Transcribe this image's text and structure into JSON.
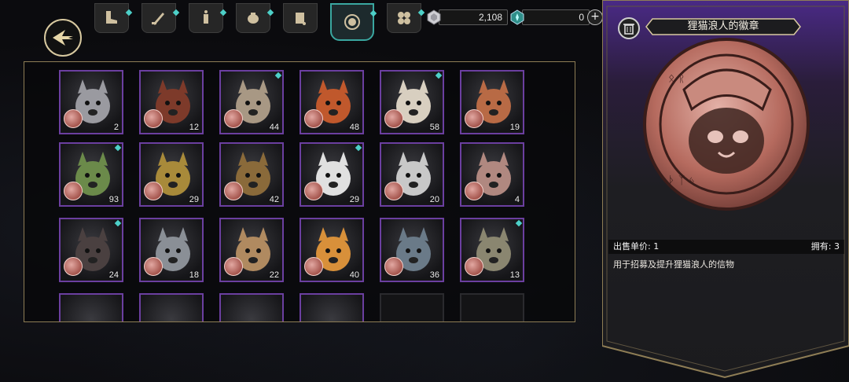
{
  "currencies": [
    {
      "icon": "silver-gem-icon",
      "value": "2,108"
    },
    {
      "icon": "teal-crystal-icon",
      "value": "0"
    }
  ],
  "tabs": [
    {
      "icon": "boot-icon",
      "new": true
    },
    {
      "icon": "sword-icon",
      "new": true
    },
    {
      "icon": "candle-icon",
      "new": true
    },
    {
      "icon": "pouch-icon",
      "new": true
    },
    {
      "icon": "scroll-icon",
      "new": false
    },
    {
      "icon": "coin-badge-icon",
      "new": true,
      "active": true
    },
    {
      "icon": "clover-icon",
      "new": true
    }
  ],
  "items": [
    {
      "count": "2",
      "new": false,
      "fur": "#9a9aa0"
    },
    {
      "count": "12",
      "new": false,
      "fur": "#7d3a2a"
    },
    {
      "count": "44",
      "new": true,
      "fur": "#a89884"
    },
    {
      "count": "48",
      "new": false,
      "fur": "#c0582c"
    },
    {
      "count": "58",
      "new": true,
      "fur": "#d8cfc0"
    },
    {
      "count": "19",
      "new": false,
      "fur": "#b86a45"
    },
    {
      "count": "93",
      "new": true,
      "fur": "#6b8a4a"
    },
    {
      "count": "29",
      "new": false,
      "fur": "#a88a3a"
    },
    {
      "count": "42",
      "new": false,
      "fur": "#8a6a3a"
    },
    {
      "count": "29",
      "new": true,
      "fur": "#e0e0e0"
    },
    {
      "count": "20",
      "new": false,
      "fur": "#c8c8c8"
    },
    {
      "count": "4",
      "new": false,
      "fur": "#b08880"
    },
    {
      "count": "24",
      "new": true,
      "fur": "#4a4040"
    },
    {
      "count": "18",
      "new": false,
      "fur": "#8a8f96"
    },
    {
      "count": "22",
      "new": false,
      "fur": "#b08a60"
    },
    {
      "count": "40",
      "new": false,
      "fur": "#d8903a"
    },
    {
      "count": "36",
      "new": false,
      "fur": "#6a7a88"
    },
    {
      "count": "13",
      "new": true,
      "fur": "#8a8670"
    }
  ],
  "detail": {
    "title": "狸猫浪人的徽章",
    "sell_price_label": "出售单价:",
    "sell_price_value": "1",
    "owned_label": "拥有:",
    "owned_value": "3",
    "description": "用于招募及提升狸猫浪人的信物"
  },
  "colors": {
    "accent_teal": "#4dd0c8",
    "card_border": "#6b3fa0",
    "frame_gold": "#8e7d55",
    "panel_purple": "#3b2466"
  }
}
